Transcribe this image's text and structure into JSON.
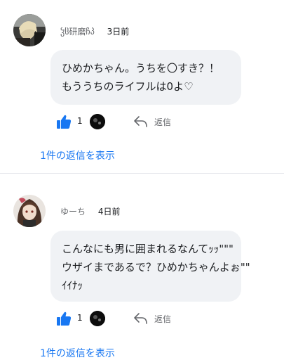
{
  "comments": [
    {
      "author": "ჴჱ研磨ჩპ",
      "time": "3日前",
      "lines": [
        "ひめかちゃん。うちを〇すき？！",
        "もううちのライフルは0よ♡"
      ],
      "like_count": "1",
      "reply_label": "返信",
      "replies_link": "1件の返信を表示"
    },
    {
      "author": "ゆーち",
      "time": "4日前",
      "lines": [
        "こんなにも男に囲まれるなんてｯｯ\"\"\"",
        "ウザイまであるで？ひめかちゃんよぉ\"\"",
        "ｲｲﾅｯ"
      ],
      "like_count": "1",
      "reply_label": "返信",
      "replies_link": "1件の返信を表示"
    }
  ],
  "colors": {
    "like_blue": "#1877f2",
    "link_blue": "#1877f2",
    "bubble_bg": "#f0f2f5"
  },
  "icons": [
    "thumbs-up-icon",
    "reply-arrow-icon"
  ]
}
